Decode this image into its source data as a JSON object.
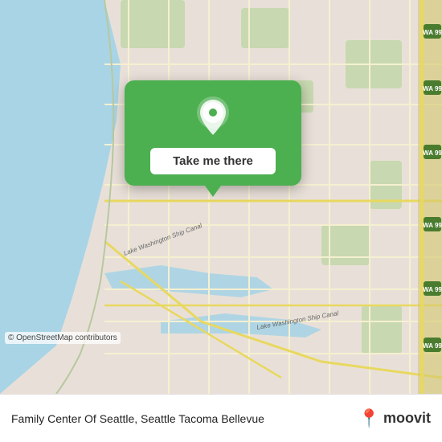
{
  "map": {
    "attribution": "© OpenStreetMap contributors",
    "background_color": "#e8e0d8"
  },
  "popup": {
    "button_label": "Take me there",
    "location_icon": "location-pin"
  },
  "bottom_bar": {
    "place_name": "Family Center Of Seattle, Seattle Tacoma Bellevue",
    "logo_text": "moovit",
    "logo_icon": "location-pin"
  }
}
